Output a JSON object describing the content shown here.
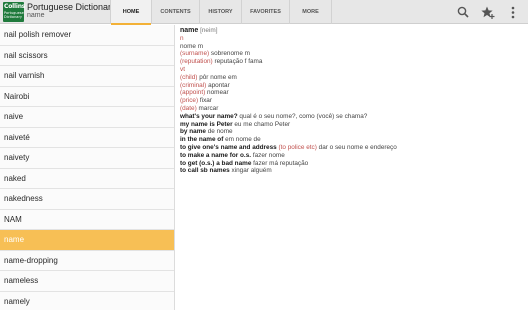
{
  "app": {
    "logo_top": "Collins",
    "logo_bottom": "Portuguese Dictionary",
    "title": "Portuguese Dictionary",
    "subtitle": "name"
  },
  "tabs": [
    {
      "label": "HOME",
      "active": true
    },
    {
      "label": "CONTENTS",
      "active": false
    },
    {
      "label": "HISTORY",
      "active": false
    },
    {
      "label": "FAVORITES",
      "active": false
    },
    {
      "label": "MORE",
      "active": false
    }
  ],
  "icons": [
    "search-icon",
    "favorite-star-icon",
    "overflow-menu-icon"
  ],
  "colors": {
    "accent": "#f3b137",
    "selected_row": "#f7bf55",
    "label_red": "#c0504d",
    "logo_green": "#1f7a3c"
  },
  "words": [
    {
      "label": "nail polish remover",
      "selected": false
    },
    {
      "label": "nail scissors",
      "selected": false
    },
    {
      "label": "nail varnish",
      "selected": false
    },
    {
      "label": "Nairobi",
      "selected": false
    },
    {
      "label": "naive",
      "selected": false
    },
    {
      "label": "naiveté",
      "selected": false
    },
    {
      "label": "naivety",
      "selected": false
    },
    {
      "label": "naked",
      "selected": false
    },
    {
      "label": "nakedness",
      "selected": false
    },
    {
      "label": "NAM",
      "selected": false
    },
    {
      "label": "name",
      "selected": true
    },
    {
      "label": "name-dropping",
      "selected": false
    },
    {
      "label": "nameless",
      "selected": false
    },
    {
      "label": "namely",
      "selected": false
    }
  ],
  "entry": {
    "headword": "name",
    "phonetic": "[neim]",
    "noun_pos": "n",
    "noun_sense": "nome m",
    "senses_n": [
      {
        "label": "(surname)",
        "translation": "sobrenome m"
      },
      {
        "label": "(reputation)",
        "translation": "reputação f fama"
      }
    ],
    "verb_pos": "vt",
    "senses_vt": [
      {
        "label": "(child)",
        "translation": "pôr nome em"
      },
      {
        "label": "(criminal)",
        "translation": "apontar"
      },
      {
        "label": "(appoint)",
        "translation": "nomear"
      },
      {
        "label": "(price)",
        "translation": "fixar"
      },
      {
        "label": "(date)",
        "translation": "marcar"
      }
    ],
    "examples": [
      {
        "phrase": "what's your name?",
        "translation": "qual é o seu nome?, como (você) se chama?"
      },
      {
        "phrase": "my name is Peter",
        "translation": "eu me chamo Peter"
      },
      {
        "phrase": "by name",
        "translation": "de nome"
      },
      {
        "phrase": "in the name of",
        "translation": "em nome de"
      },
      {
        "phrase": "to give one's name and address",
        "label": "(to police etc)",
        "translation": "dar o seu nome e endereço"
      },
      {
        "phrase": "to make a name for o.s.",
        "translation": "fazer nome"
      },
      {
        "phrase": "to get (o.s.) a bad name",
        "translation": "fazer má reputação"
      },
      {
        "phrase": "to call sb names",
        "translation": "xingar alguém"
      }
    ]
  }
}
